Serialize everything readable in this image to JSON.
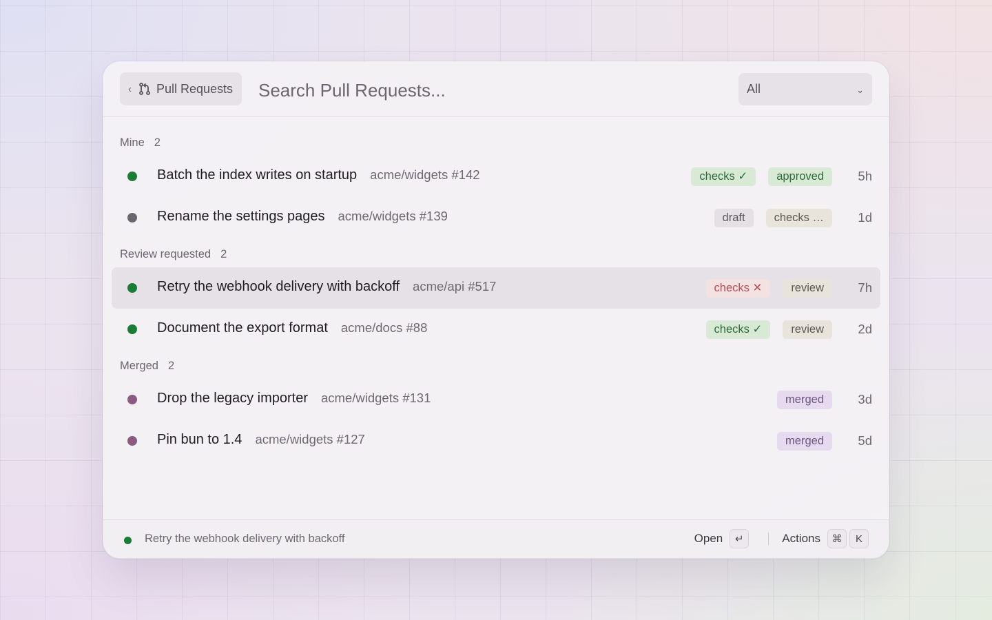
{
  "colors": {
    "open": "#1c7c35",
    "draft": "#6a6670",
    "merged": "#8a5a82"
  },
  "header": {
    "back_chevron": "‹",
    "back_icon": "pull-request-icon",
    "back_label": "Pull Requests",
    "search_placeholder": "Search Pull Requests...",
    "filter_value": "All",
    "filter_arrow": "⌄"
  },
  "sections": [
    {
      "label": "Mine",
      "count": "2",
      "rows": [
        {
          "status": "open",
          "title": "Batch the index writes on startup",
          "repo": "acme/widgets #142",
          "badges": [
            {
              "text": "checks ✓",
              "style": "green"
            },
            {
              "text": "approved",
              "style": "green"
            }
          ],
          "time": "5h"
        },
        {
          "status": "draft",
          "title": "Rename the settings pages",
          "repo": "acme/widgets #139",
          "badges": [
            {
              "text": "draft",
              "style": "gray"
            },
            {
              "text": "checks …",
              "style": "tan"
            }
          ],
          "time": "1d"
        }
      ]
    },
    {
      "label": "Review requested",
      "count": "2",
      "rows": [
        {
          "status": "open",
          "title": "Retry the webhook delivery with backoff",
          "repo": "acme/api #517",
          "badges": [
            {
              "text": "checks ✕",
              "style": "red"
            },
            {
              "text": "review",
              "style": "tan"
            }
          ],
          "time": "7h",
          "selected": true
        },
        {
          "status": "open",
          "title": "Document the export format",
          "repo": "acme/docs #88",
          "badges": [
            {
              "text": "checks ✓",
              "style": "green"
            },
            {
              "text": "review",
              "style": "tan"
            }
          ],
          "time": "2d"
        }
      ]
    },
    {
      "label": "Merged",
      "count": "2",
      "rows": [
        {
          "status": "merged",
          "title": "Drop the legacy importer",
          "repo": "acme/widgets #131",
          "badges": [
            {
              "text": "merged",
              "style": "purple"
            }
          ],
          "time": "3d"
        },
        {
          "status": "merged",
          "title": "Pin bun to 1.4",
          "repo": "acme/widgets #127",
          "badges": [
            {
              "text": "merged",
              "style": "purple"
            }
          ],
          "time": "5d"
        }
      ]
    }
  ],
  "footer": {
    "selected_title": "Retry the webhook delivery with backoff",
    "open_label": "Open",
    "open_key": "↵",
    "actions_label": "Actions",
    "actions_keys": [
      "⌘",
      "K"
    ]
  }
}
